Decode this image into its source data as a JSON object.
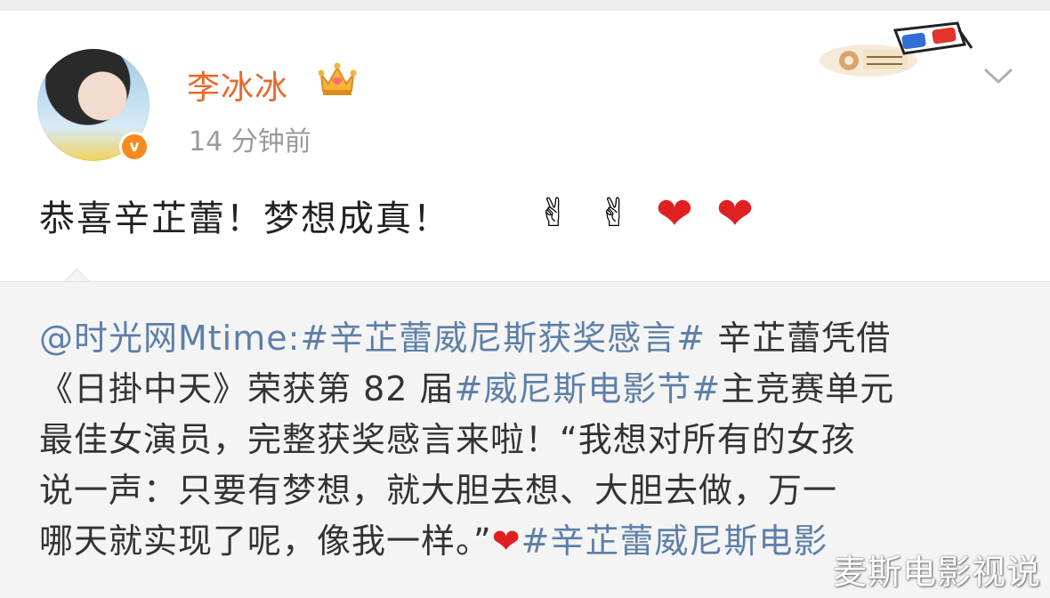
{
  "user": {
    "name": "李冰冰",
    "timestamp": "14 分钟前",
    "verified_symbol": "v"
  },
  "post": {
    "text": "恭喜辛芷蕾！梦想成真！",
    "emojis": [
      "✌",
      "✌",
      "❤",
      "❤"
    ]
  },
  "repost": {
    "mention": "@时光网Mtime:",
    "hashtag1": "#辛芷蕾威尼斯获奖感言#",
    "line1_rest": " 辛芷蕾凭借",
    "line2_pre": "《日掛中天》荣获第 82 届",
    "hashtag2": "#威尼斯电影节#",
    "line2_rest": "主竞赛单元",
    "line3": "最佳女演员，完整获奖感言来啦！“我想对所有的女孩",
    "line4": "说一声：只要有梦想，就大胆去想、大胆去做，万一",
    "line5_pre": "哪天就实现了呢，像我一样。”",
    "line5_heart": "❤",
    "hashtag3": "#辛芷蕾威尼斯电影"
  },
  "watermark": "麦斯电影视说",
  "icons": {
    "crown": "crown-icon",
    "chevron": "chevron-down-icon",
    "badge": "3d-glasses-event-badge"
  },
  "colors": {
    "name": "#e6692c",
    "link": "#5d7fa8",
    "verified": "#f78a1e",
    "heart": "#e02020"
  }
}
